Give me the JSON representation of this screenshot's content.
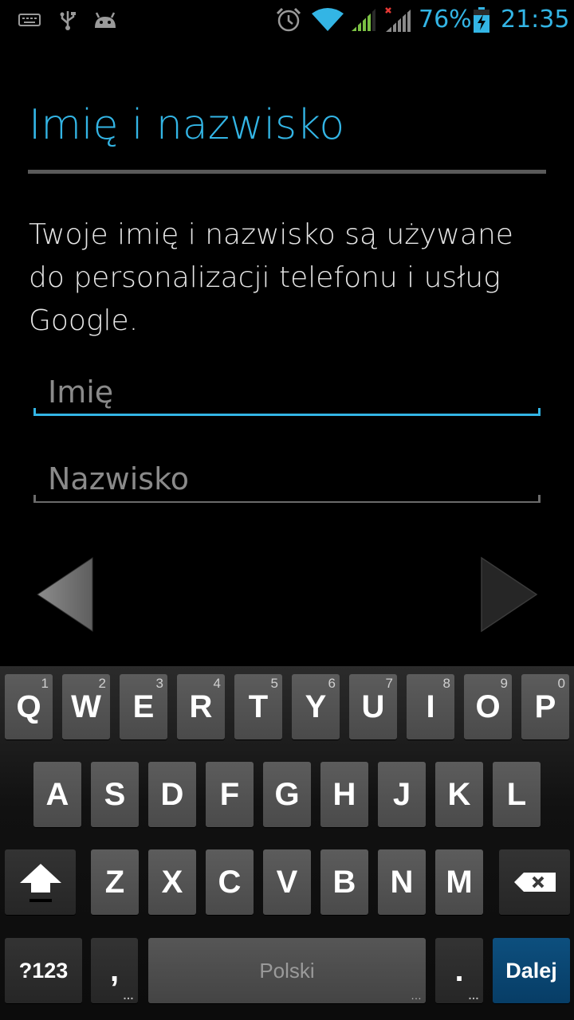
{
  "status_bar": {
    "battery_percent": "76%",
    "clock": "21:35",
    "icons": [
      "keyboard-icon",
      "usb-icon",
      "android-debug-icon",
      "alarm-icon",
      "wifi-icon",
      "signal-icon",
      "signal-no-sim-icon",
      "battery-charging-icon"
    ],
    "accent_color": "#33b5e5"
  },
  "setup": {
    "title": "Imię i nazwisko",
    "description": "Twoje imię i nazwisko są używane do personalizacji telefonu i usług Google.",
    "first_name": {
      "value": "",
      "placeholder": "Imię"
    },
    "last_name": {
      "value": "",
      "placeholder": "Nazwisko"
    },
    "back_icon": "back-arrow-icon",
    "next_icon": "next-arrow-icon"
  },
  "keyboard": {
    "row1": [
      {
        "label": "Q",
        "hint": "1"
      },
      {
        "label": "W",
        "hint": "2"
      },
      {
        "label": "E",
        "hint": "3"
      },
      {
        "label": "R",
        "hint": "4"
      },
      {
        "label": "T",
        "hint": "5"
      },
      {
        "label": "Y",
        "hint": "6"
      },
      {
        "label": "U",
        "hint": "7"
      },
      {
        "label": "I",
        "hint": "8"
      },
      {
        "label": "O",
        "hint": "9"
      },
      {
        "label": "P",
        "hint": "0"
      }
    ],
    "row2": [
      "A",
      "S",
      "D",
      "F",
      "G",
      "H",
      "J",
      "K",
      "L"
    ],
    "row3": [
      "Z",
      "X",
      "C",
      "V",
      "B",
      "N",
      "M"
    ],
    "symbols_label": "?123",
    "comma_label": ",",
    "space_label": "Polski",
    "period_label": ".",
    "action_label": "Dalej",
    "action_color": "#0a4a78"
  }
}
